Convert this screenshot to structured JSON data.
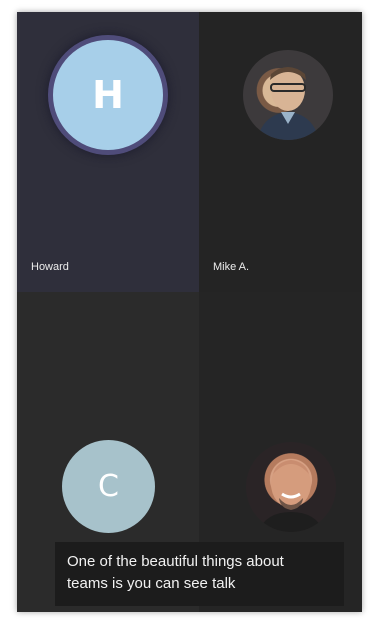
{
  "participants": [
    {
      "name": "Howard",
      "initial": "H",
      "avatar_color": "#a7cfe9",
      "ring_color": "#4f4c7a",
      "speaking": true
    },
    {
      "name": "Mike A.",
      "initial": "",
      "avatar_icon": "profile-photo-icon"
    },
    {
      "name": "",
      "initial": "C",
      "avatar_color": "#a7c2cb"
    },
    {
      "name": "",
      "initial": "",
      "avatar_icon": "profile-photo-icon"
    }
  ],
  "caption": {
    "line1": "One of the beautiful things about",
    "line2": "teams is you can see talk"
  },
  "colors": {
    "background": "#282828",
    "tile_active": "#2f2f3b",
    "caption_bg": "#1c1c1c"
  }
}
